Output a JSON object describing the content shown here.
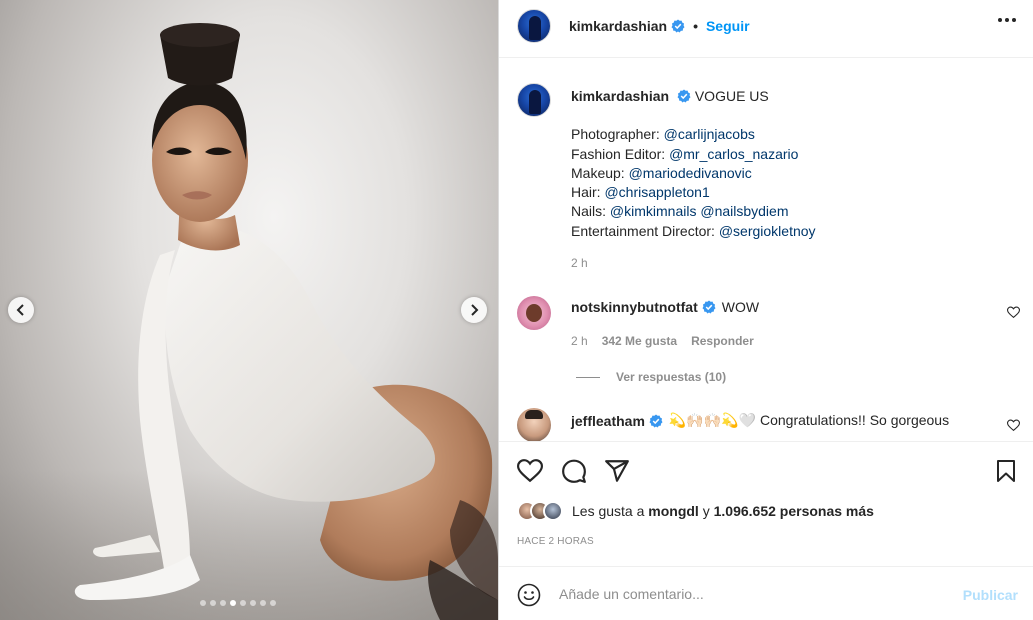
{
  "post": {
    "author": "kimkardashian",
    "follow_label": "Seguir",
    "separator": "•",
    "caption_title": "VOGUE US",
    "credits": [
      {
        "role": "Photographer: ",
        "handles": [
          "@carlijnjacobs"
        ]
      },
      {
        "role": "Fashion Editor: ",
        "handles": [
          "@mr_carlos_nazario"
        ]
      },
      {
        "role": "Makeup: ",
        "handles": [
          "@mariodedivanovic"
        ]
      },
      {
        "role": "Hair: ",
        "handles": [
          "@chrisappleton1"
        ]
      },
      {
        "role": "Nails: ",
        "handles": [
          "@kimkimnails",
          "@nailsbydiem"
        ]
      },
      {
        "role": "Entertainment Director: ",
        "handles": [
          "@sergiokletnoy"
        ]
      }
    ],
    "caption_time": "2 h"
  },
  "comments": [
    {
      "user": "notskinnybutnotfat",
      "text": "WOW",
      "time": "2 h",
      "likes": "342 Me gusta",
      "reply_label": "Responder",
      "view_replies": "Ver respuestas (10)"
    },
    {
      "user": "jeffleatham",
      "text": "💫🙌🏻🙌🏻💫🤍 Congratulations!! So gorgeous"
    }
  ],
  "carousel": {
    "slide_count": 8,
    "active_index": 3
  },
  "likes": {
    "prefix": "Les gusta a ",
    "first_liker": "mongdl",
    "middle": " y ",
    "count": "1.096.652 personas más"
  },
  "time_ago": "HACE 2 HORAS",
  "add_comment": {
    "placeholder": "Añade un comentario...",
    "publish_label": "Publicar"
  },
  "icons": {
    "header": [
      "more-options-icon",
      "verified-badge-icon"
    ],
    "actions": [
      "like-heart-icon",
      "comment-icon",
      "share-icon",
      "save-bookmark-icon"
    ],
    "other": [
      "emoji-icon",
      "carousel-prev-icon",
      "carousel-next-icon"
    ]
  },
  "colors": {
    "link": "#0095f6",
    "mention": "#00376b",
    "muted": "#8e8e8e",
    "publish_disabled": "#b2dffc"
  }
}
